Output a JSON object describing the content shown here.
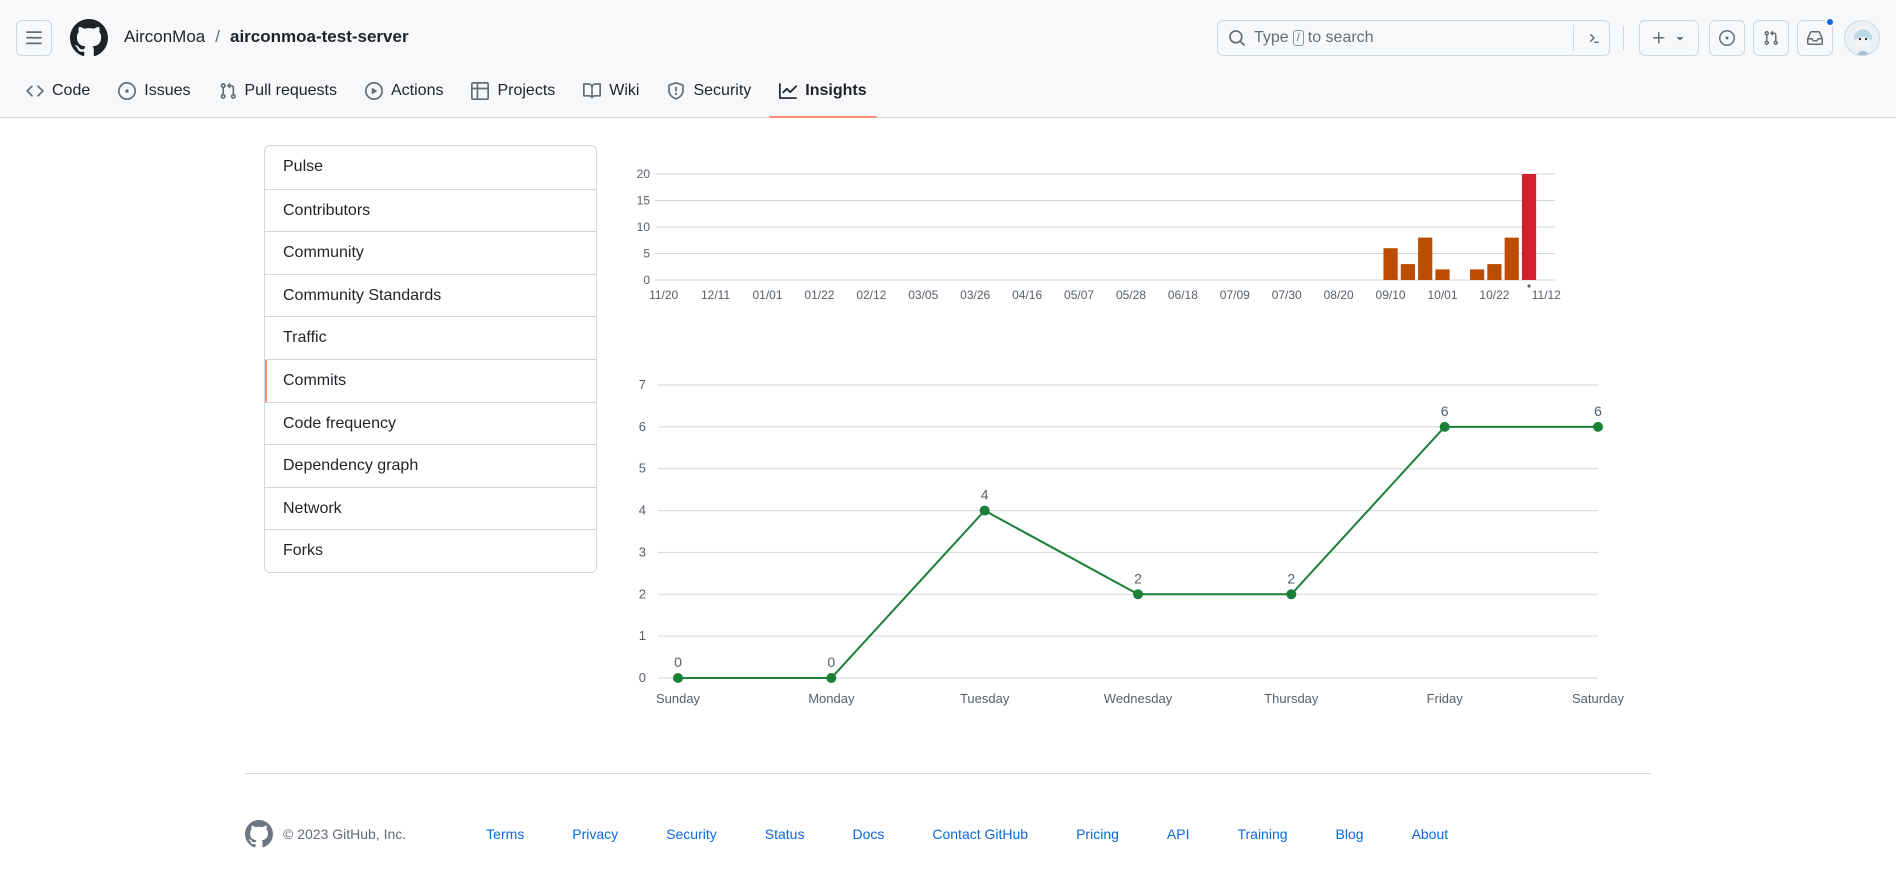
{
  "header": {
    "owner": "AirconMoa",
    "separator": "/",
    "repo": "airconmoa-test-server",
    "search_prefix": "Type",
    "search_key": "/",
    "search_suffix": "to search"
  },
  "tabs": [
    {
      "label": "Code",
      "icon": "code-icon"
    },
    {
      "label": "Issues",
      "icon": "issue-icon"
    },
    {
      "label": "Pull requests",
      "icon": "pull-request-icon"
    },
    {
      "label": "Actions",
      "icon": "play-icon"
    },
    {
      "label": "Projects",
      "icon": "table-icon"
    },
    {
      "label": "Wiki",
      "icon": "book-icon"
    },
    {
      "label": "Security",
      "icon": "shield-icon"
    },
    {
      "label": "Insights",
      "icon": "graph-icon"
    }
  ],
  "active_tab": "Insights",
  "sidebar": {
    "items": [
      "Pulse",
      "Contributors",
      "Community",
      "Community Standards",
      "Traffic",
      "Commits",
      "Code frequency",
      "Dependency graph",
      "Network",
      "Forks"
    ],
    "selected": "Commits"
  },
  "chart_data": [
    {
      "type": "bar",
      "title": "",
      "x_tick_labels": [
        "11/20",
        "12/11",
        "01/01",
        "01/22",
        "02/12",
        "03/05",
        "03/26",
        "04/16",
        "05/07",
        "05/28",
        "06/18",
        "07/09",
        "07/30",
        "08/20",
        "09/10",
        "10/01",
        "10/22",
        "11/12"
      ],
      "weeks": 52,
      "values": [
        0,
        0,
        0,
        0,
        0,
        0,
        0,
        0,
        0,
        0,
        0,
        0,
        0,
        0,
        0,
        0,
        0,
        0,
        0,
        0,
        0,
        0,
        0,
        0,
        0,
        0,
        0,
        0,
        0,
        0,
        0,
        0,
        0,
        0,
        0,
        0,
        0,
        0,
        0,
        0,
        0,
        0,
        6,
        3,
        8,
        2,
        0,
        2,
        3,
        8,
        20,
        0
      ],
      "highlight_index": 50,
      "y_ticks": [
        0,
        5,
        10,
        15,
        20
      ],
      "ylim": [
        0,
        20
      ],
      "colors": {
        "bar": "#bc4c00",
        "highlight": "#cf222e"
      },
      "grid": true
    },
    {
      "type": "line",
      "title": "",
      "categories": [
        "Sunday",
        "Monday",
        "Tuesday",
        "Wednesday",
        "Thursday",
        "Friday",
        "Saturday"
      ],
      "values": [
        0,
        0,
        4,
        2,
        2,
        6,
        6
      ],
      "y_ticks": [
        0,
        1,
        2,
        3,
        4,
        5,
        6,
        7
      ],
      "ylim": [
        0,
        7
      ],
      "colors": {
        "line": "#1a7f37"
      },
      "grid": true
    }
  ],
  "footer": {
    "copyright": "© 2023 GitHub, Inc.",
    "links": [
      "Terms",
      "Privacy",
      "Security",
      "Status",
      "Docs",
      "Contact GitHub",
      "Pricing",
      "API",
      "Training",
      "Blog",
      "About"
    ]
  }
}
